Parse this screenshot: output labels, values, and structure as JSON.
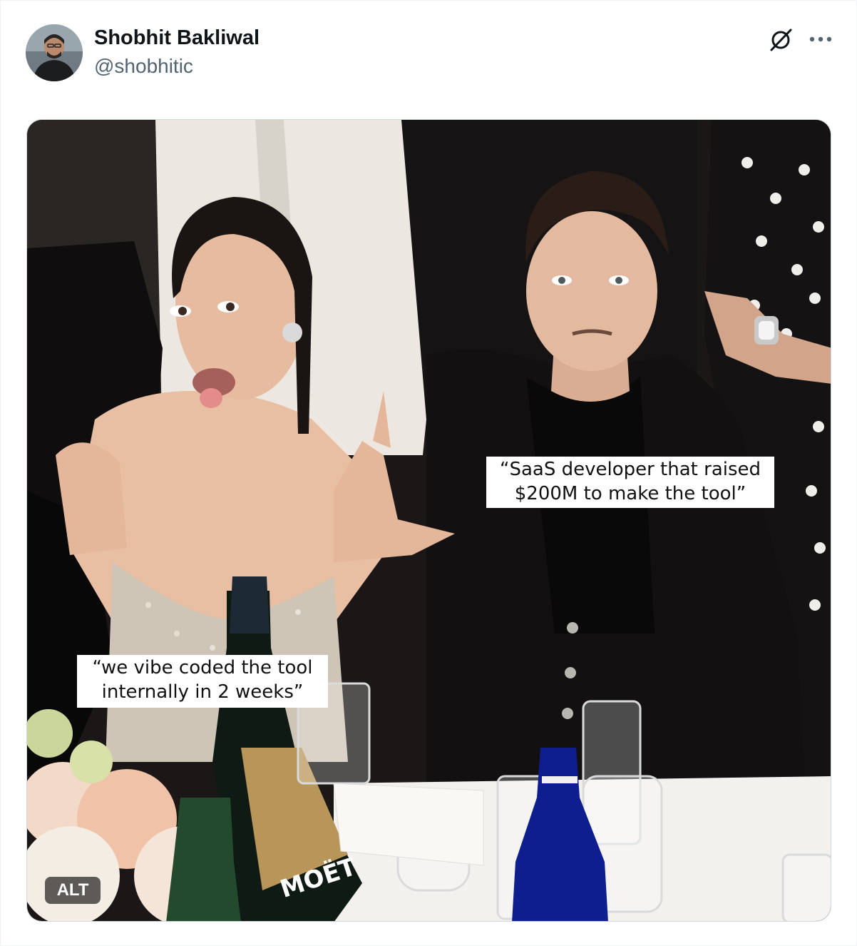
{
  "author": {
    "name": "Shobhit Bakliwal",
    "handle": "@shobhitic"
  },
  "actions": {
    "grok_icon": "grok-icon",
    "more_icon": "more-horizontal-icon"
  },
  "media": {
    "caption_top_right": "“SaaS developer that raised $200M to make the tool”",
    "caption_bottom_left": "“we vibe coded the tool internally in 2 weeks”",
    "bottle_label": "MOËT",
    "alt_label": "ALT"
  },
  "colors": {
    "text_primary": "#0f1419",
    "text_secondary": "#536471",
    "border": "#cfd9de"
  }
}
